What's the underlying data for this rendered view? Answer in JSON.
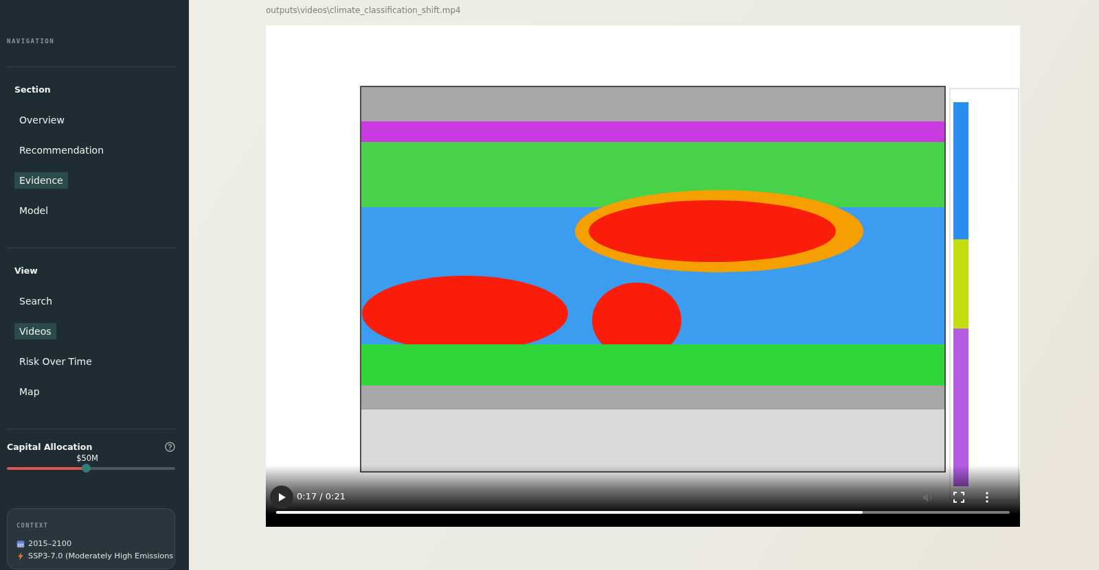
{
  "sidebar": {
    "heading": "NAVIGATION",
    "groups": [
      {
        "title": "Section",
        "items": [
          {
            "label": "Overview",
            "selected": false
          },
          {
            "label": "Recommendation",
            "selected": false
          },
          {
            "label": "Evidence",
            "selected": true
          },
          {
            "label": "Model",
            "selected": false
          }
        ]
      },
      {
        "title": "View",
        "items": [
          {
            "label": "Search",
            "selected": false
          },
          {
            "label": "Videos",
            "selected": true
          },
          {
            "label": "Risk Over Time",
            "selected": false
          },
          {
            "label": "Map",
            "selected": false
          }
        ]
      }
    ],
    "slider": {
      "label": "Capital Allocation",
      "value": "$50M",
      "level": 0.47
    },
    "context": {
      "heading": "CONTEXT",
      "items": [
        {
          "kind": "calendar",
          "text": "2015–2100"
        },
        {
          "kind": "bolt",
          "text": "SSP3-7.0 (Moderately High Emissions"
        }
      ]
    }
  },
  "main": {
    "file_path": "outputs\\videos\\climate_classification_shift.mp4",
    "video": {
      "kind": "picture",
      "playing": false,
      "time": "0:17 / 0:21",
      "level": 0.8
    }
  }
}
